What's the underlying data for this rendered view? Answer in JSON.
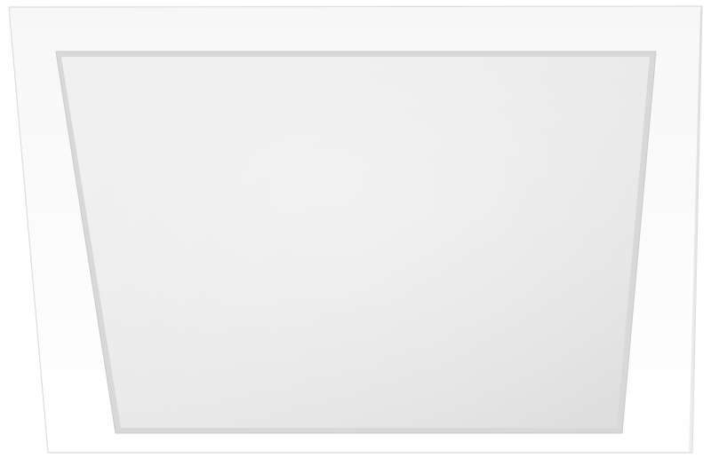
{
  "image": {
    "subject": "square-led-ceiling-panel",
    "background_color": "#ffffff",
    "frame_color": "#ffffff",
    "frame_edge_color": "#d7d7d7",
    "diffuser_color_light": "#efefef",
    "diffuser_color_dark": "#dcdcdc",
    "inner_bevel_color": "#c9c9c9"
  }
}
